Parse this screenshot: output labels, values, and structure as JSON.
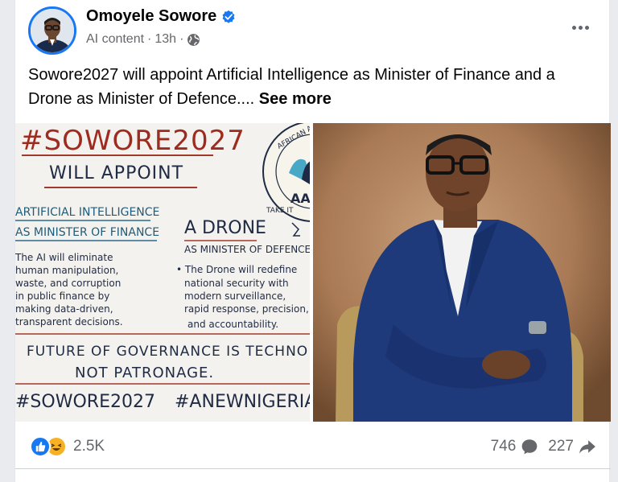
{
  "post": {
    "author": "Omoyele Sowore",
    "meta_label": "AI content",
    "meta_sep": "·",
    "meta_time": "13h",
    "meta_sep2": "·",
    "text": "Sowore2027 will appoint Artificial Intelligence as Minister of Finance and a Drone as Minister of Defence....",
    "see_more": "See more"
  },
  "image_left": {
    "lines": [
      "#SOWORE2027",
      "WILL APPOINT",
      "ARTIFICIAL INTELLIGENCE",
      "AS MINISTER OF FINANCE",
      "A DRONE",
      "AS MINISTER OF DEFENCE",
      "The AI will eliminate",
      "human manipulation,",
      "waste, and corruption",
      "in public finance by",
      "making data-driven,",
      "transparent decisions.",
      "• The Drone will redefine",
      "national security with",
      "modern surveillance,",
      "rapid response, precision,",
      "and accountability.",
      "FUTURE OF GOVERNANCE IS TECHNO",
      "NOT PATRONAGE.",
      "#SOWORE2027",
      "#ANEWNIGERIAN",
      "AFRICAN ACTIO",
      "AA",
      "TAKE IT"
    ]
  },
  "stats": {
    "reactions_count": "2.5K",
    "comments_count": "746",
    "shares_count": "227"
  },
  "colors": {
    "brand": "#1877f2",
    "secondary_text": "#65676b",
    "haha": "#f7b125"
  }
}
